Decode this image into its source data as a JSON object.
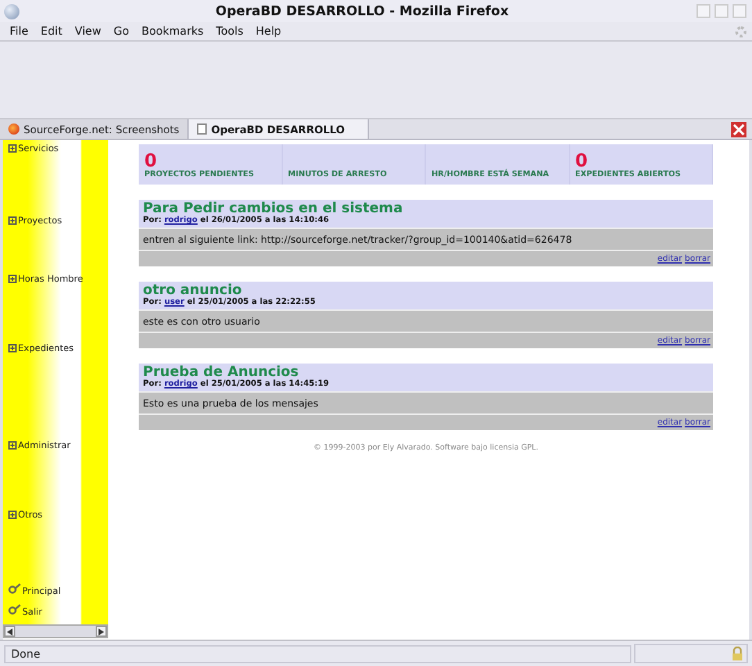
{
  "window": {
    "title": "OperaBD DESARROLLO - Mozilla Firefox"
  },
  "menu": [
    "File",
    "Edit",
    "View",
    "Go",
    "Bookmarks",
    "Tools",
    "Help"
  ],
  "tabs": [
    {
      "label": "SourceForge.net: Screenshots",
      "selected": false,
      "kind": "web"
    },
    {
      "label": "OperaBD DESARROLLO",
      "selected": true,
      "kind": "page"
    }
  ],
  "sidebar": {
    "items": [
      {
        "label": "Servicios",
        "kind": "section"
      },
      {
        "label": "Proyectos",
        "kind": "section"
      },
      {
        "label": "Horas Hombre",
        "kind": "section"
      },
      {
        "label": "Expedientes",
        "kind": "section"
      },
      {
        "label": "Administrar",
        "kind": "section"
      },
      {
        "label": "Otros",
        "kind": "section"
      },
      {
        "label": "Principal",
        "kind": "link"
      },
      {
        "label": "Salir",
        "kind": "link"
      }
    ]
  },
  "stats": [
    {
      "value": "0",
      "label": "PROYECTOS PENDIENTES"
    },
    {
      "label": "MINUTOS DE ARRESTO"
    },
    {
      "label": "HR/HOMBRE ESTÁ SEMANA"
    },
    {
      "value": "0",
      "label": "EXPEDIENTES ABIERTOS"
    }
  ],
  "posts": [
    {
      "title": "Para Pedir cambios en el sistema",
      "by": "Por:",
      "author": "rodrigo",
      "date": "el 26/01/2005 a las 14:10:46",
      "body": "entren al siguiente link: http://sourceforge.net/tracker/?group_id=100140&atid=626478",
      "actions": [
        "editar",
        "borrar"
      ]
    },
    {
      "title": "otro anuncio",
      "by": "Por:",
      "author": "user",
      "date": "el 25/01/2005 a las 22:22:55",
      "body": "este es con otro usuario",
      "actions": [
        "editar",
        "borrar"
      ]
    },
    {
      "title": "Prueba de Anuncios",
      "by": "Por:",
      "author": "rodrigo",
      "date": "el 25/01/2005 a las 14:45:19",
      "body": "Esto es una prueba de los mensajes",
      "actions": [
        "editar",
        "borrar"
      ]
    }
  ],
  "footer": "© 1999-2003 por Ely Alvarado. Software bajo licensia GPL.",
  "status_bar": {
    "text": "Done"
  }
}
